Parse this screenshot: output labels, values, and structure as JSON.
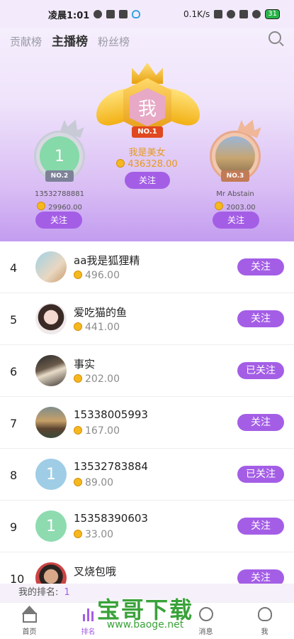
{
  "statusbar": {
    "time": "凌晨1:01",
    "speed": "0.1K/s",
    "battery": "31"
  },
  "tabs": [
    {
      "label": "贡献榜"
    },
    {
      "label": "主播榜"
    },
    {
      "label": "粉丝榜"
    }
  ],
  "top3": {
    "first": {
      "avatar_text": "我",
      "badge": "NO.1",
      "name": "我是美女",
      "score": "436328.00",
      "follow": "关注"
    },
    "second": {
      "avatar_text": "1",
      "badge": "NO.2",
      "name": "13532788881",
      "score": "29960.00",
      "follow": "关注"
    },
    "third": {
      "badge": "NO.3",
      "name": "Mr Abstain",
      "score": "2003.00",
      "follow": "关注"
    }
  },
  "list": [
    {
      "rank": "4",
      "name": "aa我是狐狸精",
      "score": "496.00",
      "follow": "关注"
    },
    {
      "rank": "5",
      "name": "爱吃猫的鱼",
      "score": "441.00",
      "follow": "关注"
    },
    {
      "rank": "6",
      "name": "事实",
      "score": "202.00",
      "follow": "已关注"
    },
    {
      "rank": "7",
      "name": "15338005993",
      "score": "167.00",
      "follow": "关注"
    },
    {
      "rank": "8",
      "name": "13532783884",
      "score": "89.00",
      "follow": "已关注",
      "avatar_text": "1"
    },
    {
      "rank": "9",
      "name": "15358390603",
      "score": "33.00",
      "follow": "关注",
      "avatar_text": "1"
    },
    {
      "rank": "10",
      "name": "叉烧包哦",
      "score": "",
      "follow": "关注"
    }
  ],
  "myrank": {
    "label": "我的排名:",
    "value": "1"
  },
  "tabbar": [
    {
      "label": "首页"
    },
    {
      "label": "排名"
    },
    {
      "label": ""
    },
    {
      "label": "消息"
    },
    {
      "label": "我"
    }
  ],
  "watermark": {
    "main": "宝哥下载",
    "sub": "www.baoge.net"
  },
  "colors": {
    "accent": "#a45ee6",
    "gold": "#e79a1b"
  }
}
